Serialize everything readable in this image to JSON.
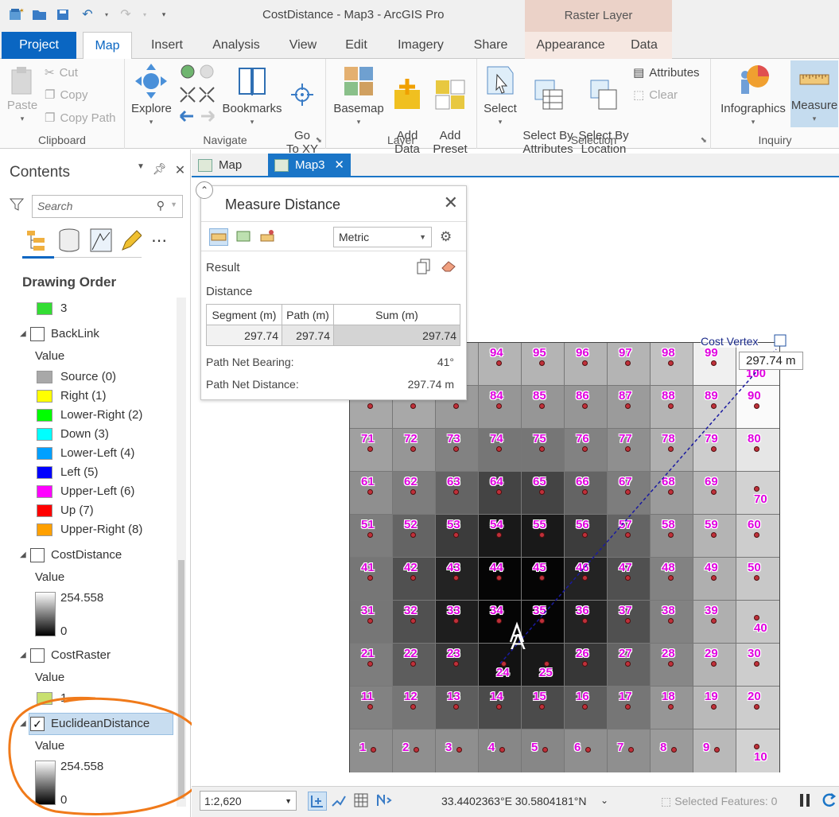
{
  "window": {
    "title": "CostDistance - Map3 - ArcGIS Pro",
    "context_header": "Raster Layer"
  },
  "ribbon_tabs": [
    "Project",
    "Map",
    "Insert",
    "Analysis",
    "View",
    "Edit",
    "Imagery",
    "Share",
    "Appearance",
    "Data"
  ],
  "ribbon": {
    "clipboard": {
      "label": "Clipboard",
      "paste": "Paste",
      "cut": "Cut",
      "copy": "Copy",
      "copy_path": "Copy Path"
    },
    "navigate": {
      "label": "Navigate",
      "explore": "Explore",
      "bookmarks": "Bookmarks",
      "go_to_xy": "Go\nTo XY"
    },
    "layer": {
      "label": "Layer",
      "basemap": "Basemap",
      "add_data": "Add\nData",
      "add_preset": "Add\nPreset"
    },
    "selection": {
      "label": "Selection",
      "select": "Select",
      "select_by_attributes": "Select By\nAttributes",
      "select_by_location": "Select By\nLocation",
      "attributes": "Attributes",
      "clear": "Clear"
    },
    "inquiry": {
      "label": "Inquiry",
      "infographics": "Infographics",
      "measure": "Measure"
    }
  },
  "contents": {
    "title": "Contents",
    "search_placeholder": "Search",
    "drawing_order": "Drawing Order",
    "top_item": {
      "label": "3",
      "color": "#33dd33"
    },
    "layers": [
      {
        "name": "BackLink",
        "checked": false,
        "value_header": "Value",
        "classes": [
          {
            "label": "Source (0)",
            "color": "#a8a8a8"
          },
          {
            "label": "Right (1)",
            "color": "#ffff00"
          },
          {
            "label": "Lower-Right (2)",
            "color": "#00ff00"
          },
          {
            "label": "Down (3)",
            "color": "#00ffff"
          },
          {
            "label": "Lower-Left (4)",
            "color": "#00a0ff"
          },
          {
            "label": "Left (5)",
            "color": "#0000ff"
          },
          {
            "label": "Upper-Left (6)",
            "color": "#ff00ff"
          },
          {
            "label": "Up (7)",
            "color": "#ff0000"
          },
          {
            "label": "Upper-Right (8)",
            "color": "#ffa000"
          }
        ]
      },
      {
        "name": "CostDistance",
        "checked": false,
        "value_header": "Value",
        "high": "254.558",
        "low": "0"
      },
      {
        "name": "CostRaster",
        "checked": false,
        "value_header": "Value",
        "single": "1",
        "color": "#c8e070"
      },
      {
        "name": "EuclideanDistance",
        "checked": true,
        "value_header": "Value",
        "high": "254.558",
        "low": "0"
      }
    ]
  },
  "map_tabs": [
    "Map",
    "Map3"
  ],
  "measure": {
    "title": "Measure Distance",
    "units": "Metric",
    "result_label": "Result",
    "distance_label": "Distance",
    "columns": [
      "Segment (m)",
      "Path (m)",
      "Sum (m)"
    ],
    "values": [
      "297.74",
      "297.74",
      "297.74"
    ],
    "bearing_label": "Path Net Bearing:",
    "bearing_value": "41°",
    "net_distance_label": "Path Net Distance:",
    "net_distance_value": "297.74 m"
  },
  "map": {
    "vertex_label": "Cost Vertex",
    "distance_tip": "297.74 m",
    "point_label": "A"
  },
  "status": {
    "scale": "1:2,620",
    "coordinates": "33.4402363°E 30.5804181°N",
    "selected_features": "Selected Features: 0"
  }
}
